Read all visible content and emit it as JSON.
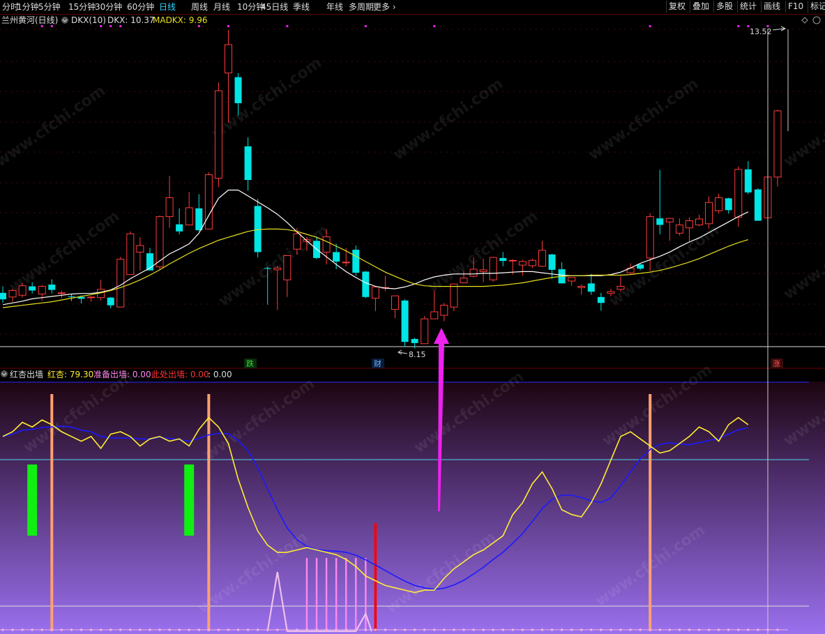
{
  "toolbar": {
    "periods": [
      "分时",
      "1分钟",
      "5分钟",
      "15分钟",
      "30分钟",
      "60分钟",
      "日线",
      "周线",
      "月线",
      "10分钟",
      "45日线",
      "季线",
      "年线",
      "多周期",
      "更多"
    ],
    "active": "日线",
    "right_buttons": [
      "复权",
      "叠加",
      "多股",
      "统计",
      "画线",
      "F10",
      "标记"
    ]
  },
  "main_panel": {
    "stock_name": "兰州黄河(日线)",
    "indicator_name": "DKX(10)",
    "dkx_label": "DKX: 10.37",
    "madkx_label": "MADKX: 9.96",
    "high_label": "13.52",
    "low_label": "8.15",
    "markers": [
      {
        "text": "跌",
        "color": "#33dd33"
      },
      {
        "text": "财",
        "color": "#44aaff"
      },
      {
        "text": "涨",
        "color": "#ff5555"
      }
    ]
  },
  "sub_panel": {
    "indicator_name": "红杏出墙",
    "hongxing_label": "红杏: 79.30",
    "zhunbei_label": "准备出墙: 0.00",
    "cichu_label": "此处出墙: 0.00",
    "extra_label": ": 0.00"
  },
  "watermark": "www.cfchi.com",
  "colors": {
    "up_candle": "#ff3c3c",
    "down_candle": "#00e5e5",
    "dkx_line": "#ffffff",
    "madkx_line": "#e8e020",
    "hongxing_line": "#ffee33",
    "blue_line": "#1a1aff",
    "arrow": "#ee22ee",
    "salmon_bar": "#ffa070",
    "green_bar": "#11ee11",
    "pink_bar": "#ff88ee",
    "red_signal": "#ff0000"
  },
  "chart_data": [
    {
      "type": "candlestick",
      "price_range": [
        8.15,
        13.52
      ],
      "candles": [
        {
          "o": 9.06,
          "h": 9.17,
          "l": 8.89,
          "c": 8.95
        },
        {
          "o": 8.99,
          "h": 9.13,
          "l": 8.91,
          "c": 9.1
        },
        {
          "o": 9.02,
          "h": 9.23,
          "l": 8.98,
          "c": 9.18
        },
        {
          "o": 9.17,
          "h": 9.24,
          "l": 9.05,
          "c": 9.1
        },
        {
          "o": 9.04,
          "h": 9.19,
          "l": 8.93,
          "c": 9.17
        },
        {
          "o": 9.2,
          "h": 9.29,
          "l": 9.05,
          "c": 9.11
        },
        {
          "o": 9.05,
          "h": 9.1,
          "l": 8.97,
          "c": 9.06
        },
        {
          "o": 9.0,
          "h": 9.04,
          "l": 8.92,
          "c": 8.99
        },
        {
          "o": 8.99,
          "h": 9.02,
          "l": 8.88,
          "c": 8.96
        },
        {
          "o": 8.99,
          "h": 9.0,
          "l": 8.91,
          "c": 8.99
        },
        {
          "o": 8.98,
          "h": 9.28,
          "l": 8.93,
          "c": 9.12
        },
        {
          "o": 8.98,
          "h": 8.99,
          "l": 8.8,
          "c": 8.85
        },
        {
          "o": 8.82,
          "h": 9.67,
          "l": 8.82,
          "c": 9.63
        },
        {
          "o": 9.37,
          "h": 10.1,
          "l": 9.37,
          "c": 10.06
        },
        {
          "o": 9.75,
          "h": 10.0,
          "l": 9.44,
          "c": 9.86
        },
        {
          "o": 9.73,
          "h": 9.82,
          "l": 9.49,
          "c": 9.44
        },
        {
          "o": 9.5,
          "h": 10.37,
          "l": 9.46,
          "c": 10.35
        },
        {
          "o": 10.35,
          "h": 11.04,
          "l": 10.16,
          "c": 10.67
        },
        {
          "o": 10.22,
          "h": 10.49,
          "l": 10.05,
          "c": 10.1
        },
        {
          "o": 10.21,
          "h": 10.77,
          "l": 10.2,
          "c": 10.5
        },
        {
          "o": 10.49,
          "h": 10.73,
          "l": 10.1,
          "c": 10.12
        },
        {
          "o": 10.14,
          "h": 11.1,
          "l": 10.14,
          "c": 11.06
        },
        {
          "o": 11.0,
          "h": 12.62,
          "l": 10.85,
          "c": 12.48
        },
        {
          "o": 12.78,
          "h": 13.51,
          "l": 11.94,
          "c": 13.26
        },
        {
          "o": 12.71,
          "h": 12.78,
          "l": 12.06,
          "c": 12.27
        },
        {
          "o": 11.54,
          "h": 11.69,
          "l": 10.79,
          "c": 10.97
        },
        {
          "o": 10.53,
          "h": 10.65,
          "l": 9.66,
          "c": 9.75
        },
        {
          "o": 9.48,
          "h": 9.5,
          "l": 8.86,
          "c": 9.47
        },
        {
          "o": 9.45,
          "h": 9.52,
          "l": 8.77,
          "c": 9.48
        },
        {
          "o": 9.28,
          "h": 9.69,
          "l": 8.99,
          "c": 9.69
        },
        {
          "o": 9.8,
          "h": 10.16,
          "l": 9.71,
          "c": 10.06
        },
        {
          "o": 9.93,
          "h": 10.01,
          "l": 9.77,
          "c": 9.96
        },
        {
          "o": 9.94,
          "h": 10.0,
          "l": 9.63,
          "c": 9.65
        },
        {
          "o": 9.75,
          "h": 10.14,
          "l": 9.54,
          "c": 10.01
        },
        {
          "o": 9.75,
          "h": 9.89,
          "l": 9.46,
          "c": 9.59
        },
        {
          "o": 9.58,
          "h": 9.82,
          "l": 9.51,
          "c": 9.58
        },
        {
          "o": 9.79,
          "h": 9.86,
          "l": 9.35,
          "c": 9.4
        },
        {
          "o": 9.42,
          "h": 9.43,
          "l": 8.97,
          "c": 8.99
        },
        {
          "o": 8.97,
          "h": 9.11,
          "l": 8.75,
          "c": 9.16
        },
        {
          "o": 9.15,
          "h": 9.35,
          "l": 9.09,
          "c": 9.15
        },
        {
          "o": 8.78,
          "h": 8.89,
          "l": 8.63,
          "c": 9.01
        },
        {
          "o": 8.93,
          "h": 8.95,
          "l": 8.15,
          "c": 8.23
        },
        {
          "o": 8.28,
          "h": 8.3,
          "l": 8.12,
          "c": 8.21
        },
        {
          "o": 8.2,
          "h": 8.67,
          "l": 8.2,
          "c": 8.62
        },
        {
          "o": 8.62,
          "h": 9.1,
          "l": 8.62,
          "c": 8.74
        },
        {
          "o": 8.68,
          "h": 8.89,
          "l": 8.58,
          "c": 8.85
        },
        {
          "o": 8.82,
          "h": 9.12,
          "l": 8.75,
          "c": 9.21
        },
        {
          "o": 9.23,
          "h": 9.43,
          "l": 9.23,
          "c": 9.31
        },
        {
          "o": 9.34,
          "h": 9.66,
          "l": 9.32,
          "c": 9.46
        },
        {
          "o": 9.42,
          "h": 9.64,
          "l": 9.24,
          "c": 9.45
        },
        {
          "o": 9.28,
          "h": 9.67,
          "l": 9.25,
          "c": 9.66
        },
        {
          "o": 9.65,
          "h": 9.75,
          "l": 9.51,
          "c": 9.6
        },
        {
          "o": 9.61,
          "h": 9.63,
          "l": 9.37,
          "c": 9.61
        },
        {
          "o": 9.53,
          "h": 9.62,
          "l": 9.35,
          "c": 9.59
        },
        {
          "o": 9.52,
          "h": 9.64,
          "l": 9.48,
          "c": 9.61
        },
        {
          "o": 9.51,
          "h": 9.94,
          "l": 9.5,
          "c": 9.78
        },
        {
          "o": 9.71,
          "h": 9.72,
          "l": 9.3,
          "c": 9.45
        },
        {
          "o": 9.46,
          "h": 9.58,
          "l": 9.29,
          "c": 9.22
        },
        {
          "o": 9.26,
          "h": 9.31,
          "l": 9.18,
          "c": 9.32
        },
        {
          "o": 9.15,
          "h": 9.2,
          "l": 9.03,
          "c": 9.17
        },
        {
          "o": 9.22,
          "h": 9.38,
          "l": 9.03,
          "c": 9.08
        },
        {
          "o": 8.99,
          "h": 9.06,
          "l": 8.76,
          "c": 8.89
        },
        {
          "o": 9.05,
          "h": 9.13,
          "l": 9.0,
          "c": 9.08
        },
        {
          "o": 9.12,
          "h": 9.34,
          "l": 9.08,
          "c": 9.17
        },
        {
          "o": 9.4,
          "h": 9.56,
          "l": 9.38,
          "c": 9.48
        },
        {
          "o": 9.54,
          "h": 9.55,
          "l": 9.44,
          "c": 9.47
        },
        {
          "o": 9.65,
          "h": 10.41,
          "l": 9.43,
          "c": 10.35
        },
        {
          "o": 10.32,
          "h": 11.14,
          "l": 10.05,
          "c": 10.21
        },
        {
          "o": 10.26,
          "h": 10.33,
          "l": 9.94,
          "c": 10.32
        },
        {
          "o": 10.07,
          "h": 10.32,
          "l": 10.03,
          "c": 10.21
        },
        {
          "o": 10.16,
          "h": 10.34,
          "l": 9.93,
          "c": 10.28
        },
        {
          "o": 10.21,
          "h": 10.38,
          "l": 10.19,
          "c": 10.31
        },
        {
          "o": 10.23,
          "h": 10.69,
          "l": 10.15,
          "c": 10.59
        },
        {
          "o": 10.45,
          "h": 10.74,
          "l": 10.4,
          "c": 10.67
        },
        {
          "o": 10.66,
          "h": 10.67,
          "l": 10.4,
          "c": 10.46
        },
        {
          "o": 10.34,
          "h": 11.2,
          "l": 10.18,
          "c": 11.15
        },
        {
          "o": 11.15,
          "h": 11.29,
          "l": 10.73,
          "c": 10.76
        },
        {
          "o": 10.81,
          "h": 10.83,
          "l": 10.28,
          "c": 10.28
        },
        {
          "o": 10.33,
          "h": 11.02,
          "l": 10.24,
          "c": 11.02
        },
        {
          "o": 11.02,
          "h": 12.16,
          "l": 10.86,
          "c": 12.14
        }
      ],
      "dkx": [
        8.86,
        8.89,
        8.92,
        8.96,
        8.98,
        9.0,
        9.02,
        9.04,
        9.05,
        9.05,
        9.07,
        9.11,
        9.19,
        9.3,
        9.39,
        9.48,
        9.6,
        9.72,
        9.8,
        9.89,
        10.07,
        10.37,
        10.66,
        10.8,
        10.8,
        10.7,
        10.6,
        10.5,
        10.39,
        10.25,
        10.09,
        9.94,
        9.8,
        9.67,
        9.54,
        9.42,
        9.32,
        9.23,
        9.17,
        9.14,
        9.13,
        9.16,
        9.21,
        9.28,
        9.33,
        9.36,
        9.38,
        9.38,
        9.38,
        9.39,
        9.39,
        9.4,
        9.41,
        9.42,
        9.42,
        9.4,
        9.38,
        9.36,
        9.35,
        9.35,
        9.35,
        9.35,
        9.37,
        9.41,
        9.48,
        9.56,
        9.62,
        9.68,
        9.75,
        9.84,
        9.92,
        9.99,
        10.08,
        10.17,
        10.26,
        10.35,
        10.43
      ],
      "madkx": [
        8.81,
        8.83,
        8.85,
        8.87,
        8.89,
        8.91,
        8.94,
        8.97,
        9.0,
        9.03,
        9.06,
        9.1,
        9.15,
        9.21,
        9.28,
        9.36,
        9.45,
        9.55,
        9.64,
        9.73,
        9.81,
        9.88,
        9.95,
        10.0,
        10.05,
        10.1,
        10.13,
        10.14,
        10.14,
        10.13,
        10.1,
        10.05,
        10.0,
        9.93,
        9.85,
        9.77,
        9.68,
        9.59,
        9.5,
        9.41,
        9.34,
        9.27,
        9.21,
        9.18,
        9.17,
        9.17,
        9.17,
        9.17,
        9.17,
        9.17,
        9.18,
        9.19,
        9.21,
        9.23,
        9.26,
        9.29,
        9.32,
        9.34,
        9.35,
        9.35,
        9.36,
        9.36,
        9.36,
        9.36,
        9.37,
        9.39,
        9.41,
        9.44,
        9.48,
        9.53,
        9.58,
        9.64,
        9.71,
        9.78,
        9.85,
        9.91,
        9.96
      ]
    },
    {
      "type": "line",
      "series": [
        {
          "name": "红杏",
          "values": [
            80,
            82,
            86,
            84,
            87,
            85,
            82,
            80,
            78,
            80,
            75,
            81,
            82,
            80,
            76,
            79,
            80,
            78,
            79,
            76,
            83,
            88,
            84,
            77,
            62,
            50,
            40,
            34,
            31,
            31,
            32,
            33,
            32,
            31,
            30,
            28,
            25,
            21,
            19,
            17,
            16,
            15,
            14,
            15,
            15,
            20,
            24,
            27,
            30,
            32,
            35,
            38,
            47,
            52,
            60,
            65,
            58,
            49,
            47,
            46,
            52,
            60,
            70,
            80,
            82,
            79,
            76,
            73,
            74,
            77,
            80,
            84,
            82,
            78,
            85,
            88,
            85
          ],
          "display_value": "79.30"
        },
        {
          "name": "准备出墙",
          "values": [
            0.0
          ]
        },
        {
          "name": "此处出墙",
          "values": [
            0.0
          ]
        }
      ]
    }
  ]
}
